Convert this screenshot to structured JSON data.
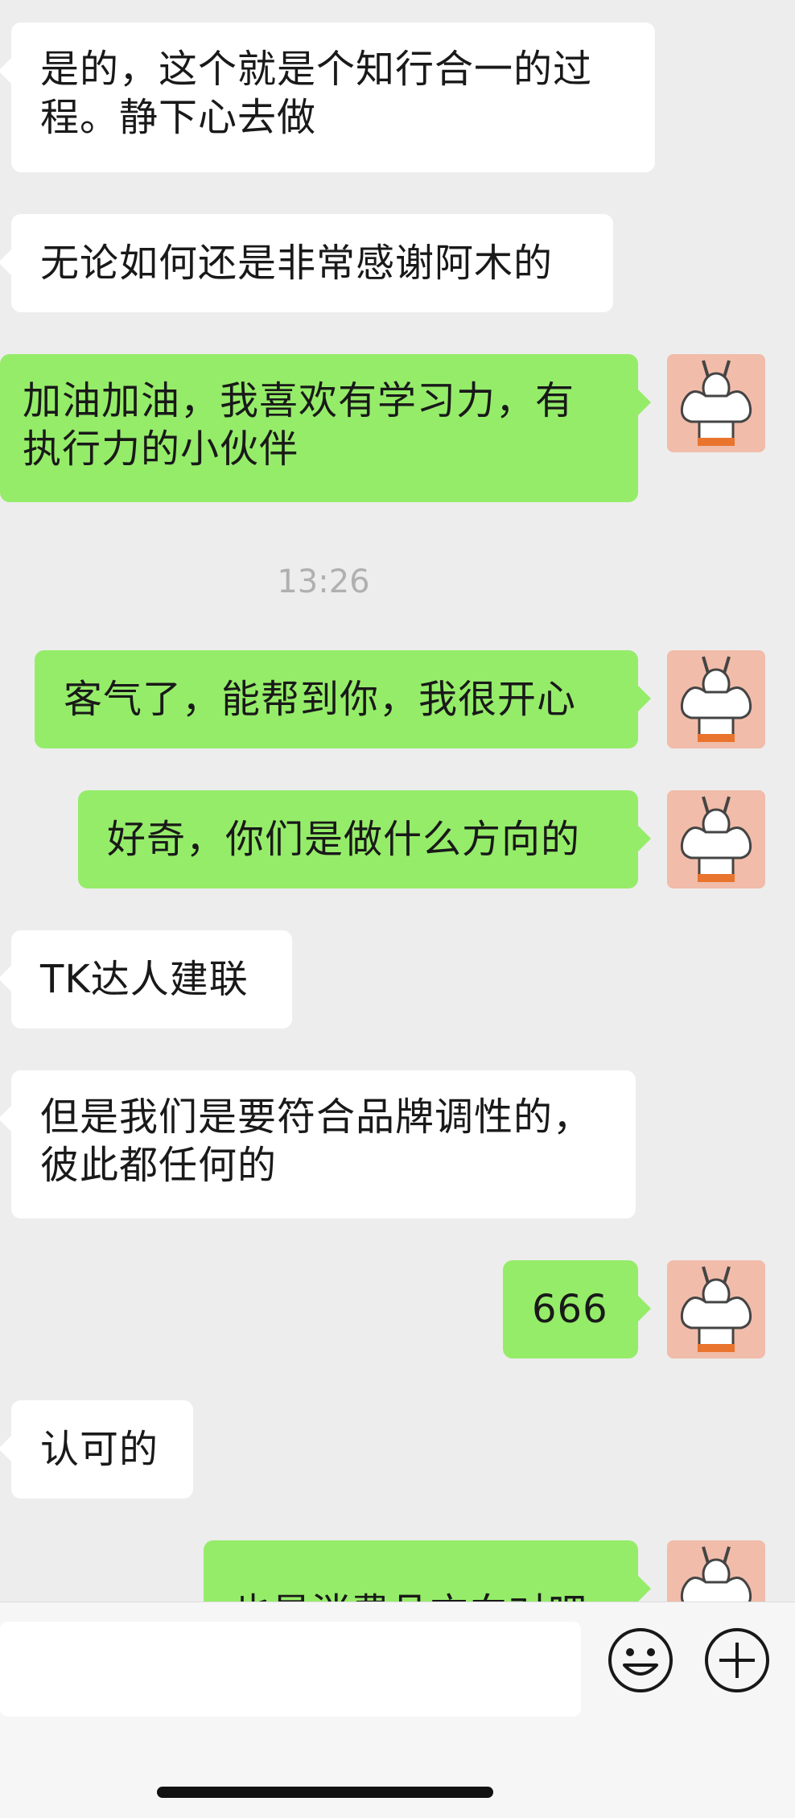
{
  "messages": [
    {
      "side": "left",
      "text_lines": [
        "是的，这个就是个知行合一的过",
        "程。静下心去做"
      ]
    },
    {
      "side": "left",
      "text": "无论如何还是非常感谢阿木的"
    },
    {
      "side": "right",
      "text_lines": [
        "加油加油，我喜欢有学习力，有",
        "执行力的小伙伴"
      ]
    },
    {
      "side": "right",
      "text": "客气了，能帮到你，我很开心"
    },
    {
      "side": "right",
      "text": "好奇，你们是做什么方向的"
    },
    {
      "side": "left",
      "text": "TK达人建联"
    },
    {
      "side": "left",
      "text_lines": [
        "但是我们是要符合品牌调性的，",
        "彼此都任何的"
      ]
    },
    {
      "side": "right",
      "text": "666"
    },
    {
      "side": "left",
      "text": "认可的"
    },
    {
      "side": "right",
      "text": "也是消费品方向对吧"
    }
  ],
  "timestamp": "13:26",
  "input_bar": {
    "emoji_icon": "smiley-face-icon",
    "plus_icon": "plus-circle-icon"
  },
  "colors": {
    "background": "#ededed",
    "own_bubble": "#95ec69",
    "other_bubble": "#ffffff",
    "avatar_bg": "#f1bca9"
  }
}
